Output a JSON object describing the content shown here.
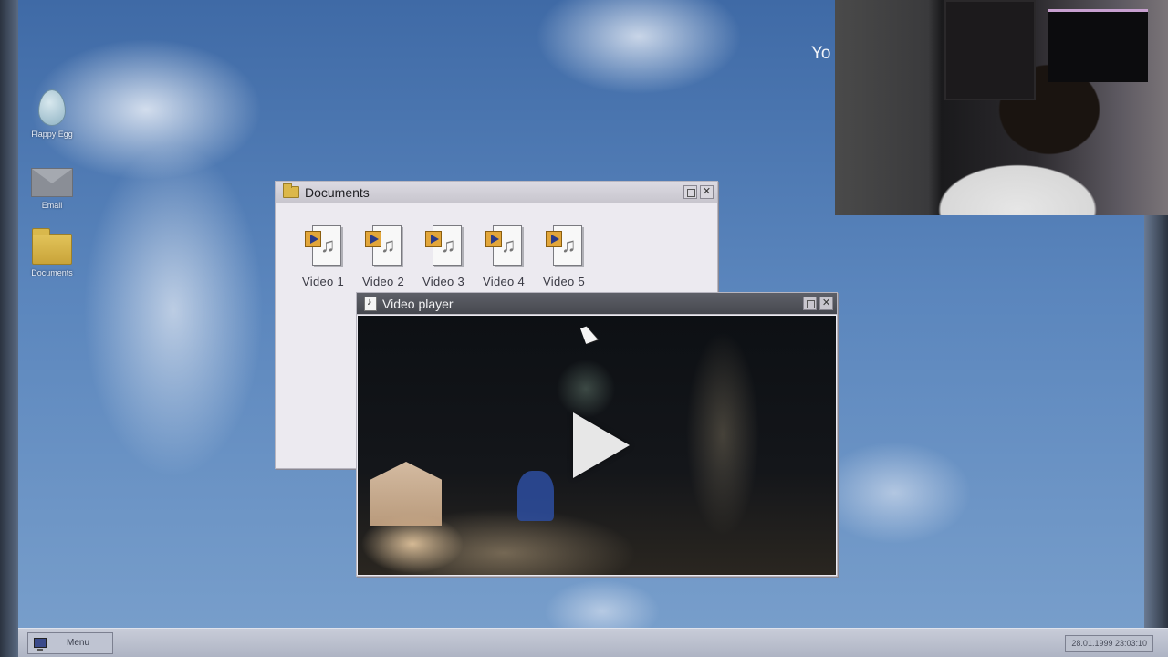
{
  "desktop": {
    "icons": [
      {
        "label": "Flappy Egg",
        "icon": "egg-icon"
      },
      {
        "label": "Email",
        "icon": "envelope-icon"
      },
      {
        "label": "Documents",
        "icon": "folder-icon"
      }
    ],
    "overlay_text": "Yo"
  },
  "documents_window": {
    "title": "Documents",
    "files": [
      {
        "label": "Video 1"
      },
      {
        "label": "Video 2"
      },
      {
        "label": "Video 3"
      },
      {
        "label": "Video 4"
      },
      {
        "label": "Video 5"
      }
    ]
  },
  "player_window": {
    "title": "Video player"
  },
  "taskbar": {
    "menu_label": "Menu",
    "clock": "28.01.1999 23:03:10"
  },
  "colors": {
    "sky": "#5b86bd",
    "window_bg": "#eceaf0",
    "player_title_bg": "#4f5158",
    "folder": "#dcb84a",
    "play_badge": "#e2a63a"
  }
}
